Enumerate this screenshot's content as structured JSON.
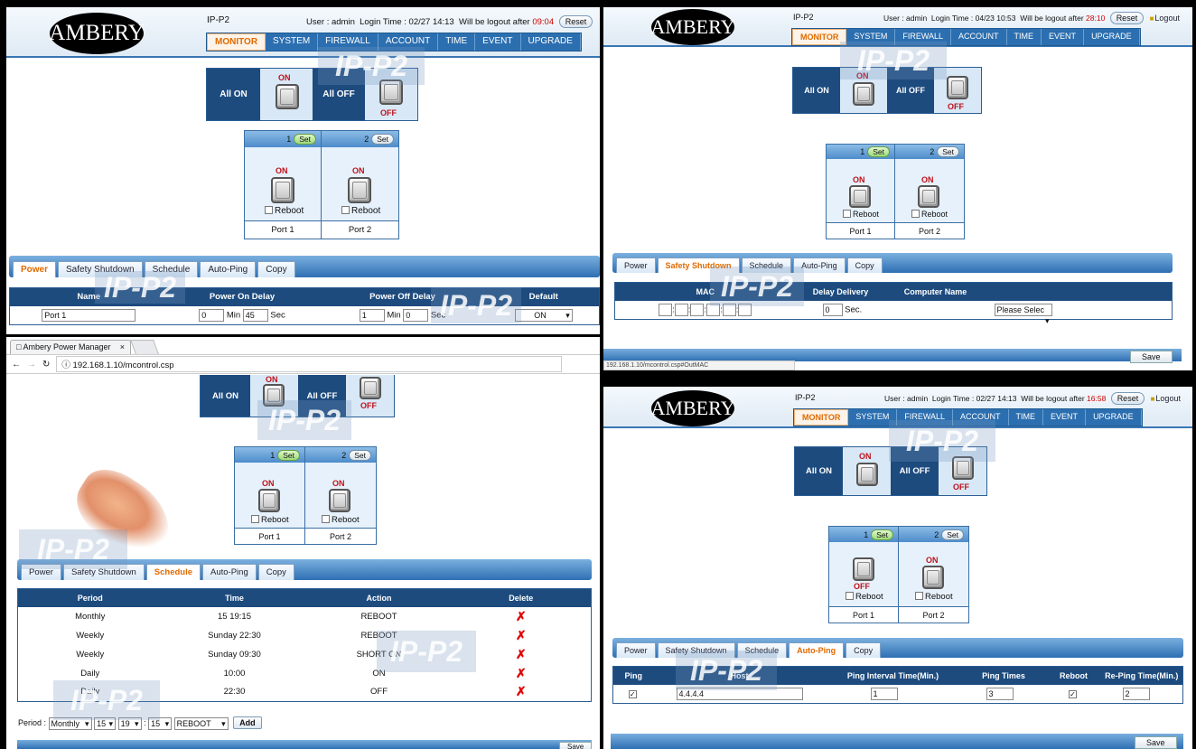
{
  "app": {
    "brand": "AMBERY",
    "device": "IP-P2",
    "user_label": "User : admin",
    "login_label": "Login Time :",
    "logout_label": "Will be logout after",
    "reset": "Reset",
    "logout": "Logout",
    "watermark": "IP-P2"
  },
  "nav": [
    "MONITOR",
    "SYSTEM",
    "FIREWALL",
    "ACCOUNT",
    "TIME",
    "EVENT",
    "UPGRADE"
  ],
  "tabs": [
    "Power",
    "Safety Shutdown",
    "Schedule",
    "Auto-Ping",
    "Copy"
  ],
  "all_on": "All ON",
  "all_off": "All OFF",
  "on": "ON",
  "off": "OFF",
  "set": "Set",
  "reboot": "Reboot",
  "ports": [
    {
      "num": "1",
      "label": "Port 1"
    },
    {
      "num": "2",
      "label": "Port 2"
    }
  ],
  "panel_a": {
    "login_time": "02/27 14:13",
    "countdown": "09:04",
    "power_table": {
      "headers": [
        "Name",
        "Power On Delay",
        "Power Off Delay",
        "Default"
      ],
      "name": "Port 1",
      "on_min": "0",
      "min": "Min",
      "on_sec": "45",
      "sec": "Sec",
      "off_min": "1",
      "off_sec": "0",
      "default": "ON"
    }
  },
  "panel_b": {
    "login_time": "04/23 10:53",
    "countdown": "28:10",
    "mac_table": {
      "headers": [
        "MAC",
        "Delay Delivery",
        "Computer Name"
      ],
      "delay": "0",
      "sec": "Sec.",
      "computer": "Please Selec"
    },
    "save": "Save",
    "status_url": "192.168.1.10/mcontrol.csp#OutMAC"
  },
  "panel_c": {
    "browser_tab": "Ambery Power Manager",
    "tab_close": "×",
    "url": "192.168.1.10/mcontrol.csp",
    "schedule_table": {
      "headers": [
        "Period",
        "Time",
        "Action",
        "Delete"
      ],
      "rows": [
        {
          "period": "Monthly",
          "time": "15 19:15",
          "action": "REBOOT"
        },
        {
          "period": "Weekly",
          "time": "Sunday 22:30",
          "action": "REBOOT"
        },
        {
          "period": "Weekly",
          "time": "Sunday 09:30",
          "action": "SHORT ON"
        },
        {
          "period": "Daily",
          "time": "10:00",
          "action": "ON"
        },
        {
          "period": "Daily",
          "time": "22:30",
          "action": "OFF"
        }
      ],
      "delete_mark": "✗"
    },
    "period_label": "Period :",
    "period_val": "Monthly",
    "day_val": "15",
    "hour_val": "19",
    "colon": ":",
    "minute_val": "15",
    "action_val": "REBOOT",
    "add": "Add",
    "save": "Save"
  },
  "panel_d": {
    "login_time": "02/27 14:13",
    "countdown": "16:58",
    "ping_table": {
      "headers": [
        "Ping",
        "Host",
        "Ping Interval Time(Min.)",
        "Ping Times",
        "Reboot",
        "Re-Ping Time(Min.)"
      ],
      "ping_checked": "✓",
      "host": "4.4.4.4",
      "interval": "1",
      "times": "3",
      "reboot_checked": "✓",
      "reping": "2"
    },
    "save": "Save"
  }
}
